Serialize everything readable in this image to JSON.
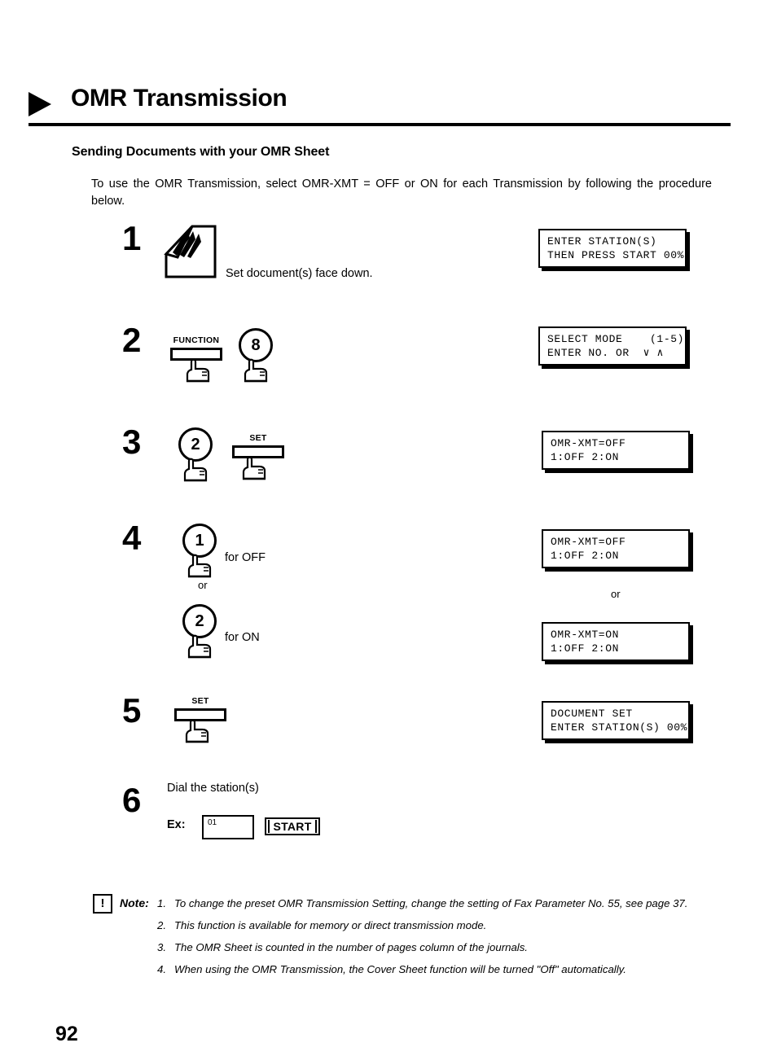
{
  "page": {
    "title": "OMR Transmission",
    "section_heading": "Sending Documents with your OMR Sheet",
    "intro": "To use the OMR Transmission, select OMR-XMT = OFF or ON for each Transmission by following the procedure below.",
    "page_number": "92"
  },
  "steps": {
    "one": {
      "number": "1",
      "caption": "Set document(s) face down.",
      "lcd": "ENTER STATION(S)\nTHEN PRESS START 00%"
    },
    "two": {
      "number": "2",
      "function_key_label": "FUNCTION",
      "numeric_key": "8",
      "lcd": "SELECT MODE    (1-5)\nENTER NO. OR  ∨ ∧"
    },
    "three": {
      "number": "3",
      "numeric_key": "2",
      "set_key_label": "SET",
      "lcd": "OMR-XMT=OFF\n1:OFF 2:ON"
    },
    "four": {
      "number": "4",
      "numeric_key_off": "1",
      "caption_off": "for OFF",
      "or_label": "or",
      "numeric_key_on": "2",
      "caption_on": "for ON",
      "lcd_off": "OMR-XMT=OFF\n1:OFF 2:ON",
      "lcd_or_label": "or",
      "lcd_on": "OMR-XMT=ON\n1:OFF 2:ON"
    },
    "five": {
      "number": "5",
      "set_key_label": "SET",
      "lcd": "DOCUMENT SET\nENTER STATION(S) 00%"
    },
    "six": {
      "number": "6",
      "caption": "Dial the station(s)",
      "ex_label": "Ex:",
      "station_value": "01",
      "start_button_label": "START"
    }
  },
  "notes": {
    "icon_glyph": "!",
    "label": "Note:",
    "items": [
      {
        "num": "1.",
        "text": "To change the preset OMR Transmission Setting, change the setting of Fax Parameter No. 55, see page 37."
      },
      {
        "num": "2.",
        "text": "This function is available for memory or direct transmission mode."
      },
      {
        "num": "3.",
        "text": "The OMR Sheet is counted in the number of pages column of the journals."
      },
      {
        "num": "4.",
        "text": "When using the OMR Transmission, the Cover Sheet function will be turned \"Off\" automatically."
      }
    ]
  },
  "colors": {
    "ink": "#000000",
    "paper": "#ffffff"
  }
}
